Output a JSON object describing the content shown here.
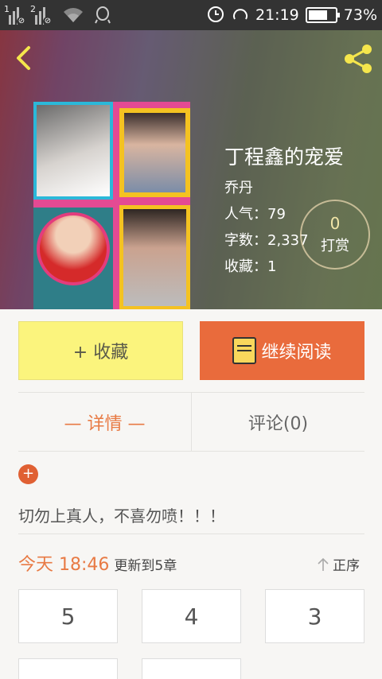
{
  "status_bar": {
    "sim1": "1",
    "sim2": "2",
    "time": "21:19",
    "battery": "73%",
    "battery_level": 0.73
  },
  "header": {
    "back_icon": "chevron-left-icon",
    "share_icon": "share-icon"
  },
  "book": {
    "title": "丁程鑫的宠爱",
    "author": "乔丹",
    "popularity": "人气：79",
    "word_count": "字数：2,337",
    "favorites": "收藏：1",
    "reward_count": "0",
    "reward_label": "打赏"
  },
  "actions": {
    "collect_label": "+ 收藏",
    "read_label": "继续阅读"
  },
  "tabs": [
    {
      "label": "— 详情 —",
      "active": true
    },
    {
      "label": "评论(0)",
      "active": false
    }
  ],
  "description": "切勿上真人，不喜勿喷！！！",
  "update": {
    "when": "今天 18:46",
    "text": "更新到5章",
    "order_label": "正序"
  },
  "chapters": [
    "5",
    "4",
    "3",
    "",
    ""
  ],
  "colors": {
    "accent": "#e87a44",
    "read_button": "#e96b3c",
    "collect_button": "#fbf47d",
    "plus_badge": "#e06033"
  }
}
